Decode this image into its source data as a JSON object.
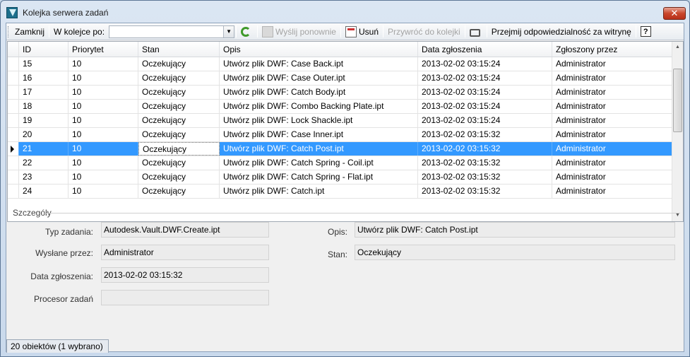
{
  "window": {
    "title": "Kolejka serwera zadań",
    "close_label": "✕"
  },
  "toolbar": {
    "close_label": "Zamknij",
    "queue_label": "W kolejce po:",
    "queue_value": "",
    "resend_label": "Wyślij ponownie",
    "delete_label": "Usuń",
    "restore_label": "Przywróć do kolejki",
    "take_label": "Przejmij odpowiedzialność za witrynę",
    "help_label": "?"
  },
  "grid": {
    "columns": [
      "ID",
      "Priorytet",
      "Stan",
      "Opis",
      "Data zgłoszenia",
      "Zgłoszony przez"
    ],
    "rows": [
      [
        "15",
        "10",
        "Oczekujący",
        "Utwórz plik DWF: Case Back.ipt",
        "2013-02-02 03:15:24",
        "Administrator"
      ],
      [
        "16",
        "10",
        "Oczekujący",
        "Utwórz plik DWF: Case Outer.ipt",
        "2013-02-02 03:15:24",
        "Administrator"
      ],
      [
        "17",
        "10",
        "Oczekujący",
        "Utwórz plik DWF: Catch Body.ipt",
        "2013-02-02 03:15:24",
        "Administrator"
      ],
      [
        "18",
        "10",
        "Oczekujący",
        "Utwórz plik DWF: Combo Backing Plate.ipt",
        "2013-02-02 03:15:24",
        "Administrator"
      ],
      [
        "19",
        "10",
        "Oczekujący",
        "Utwórz plik DWF: Lock Shackle.ipt",
        "2013-02-02 03:15:24",
        "Administrator"
      ],
      [
        "20",
        "10",
        "Oczekujący",
        "Utwórz plik DWF: Case Inner.ipt",
        "2013-02-02 03:15:32",
        "Administrator"
      ],
      [
        "21",
        "10",
        "Oczekujący",
        "Utwórz plik DWF: Catch Post.ipt",
        "2013-02-02 03:15:32",
        "Administrator"
      ],
      [
        "22",
        "10",
        "Oczekujący",
        "Utwórz plik DWF: Catch Spring - Coil.ipt",
        "2013-02-02 03:15:32",
        "Administrator"
      ],
      [
        "23",
        "10",
        "Oczekujący",
        "Utwórz plik DWF: Catch Spring - Flat.ipt",
        "2013-02-02 03:15:32",
        "Administrator"
      ],
      [
        "24",
        "10",
        "Oczekujący",
        "Utwórz plik DWF: Catch.ipt",
        "2013-02-02 03:15:32",
        "Administrator"
      ]
    ],
    "selected_index": 6
  },
  "details": {
    "section_label": "Szczegóły",
    "job_type_label": "Typ zadania:",
    "job_type_value": "Autodesk.Vault.DWF.Create.ipt",
    "sent_by_label": "Wysłane przez:",
    "sent_by_value": "Administrator",
    "submit_date_label": "Data zgłoszenia:",
    "submit_date_value": "2013-02-02 03:15:32",
    "processor_label": "Procesor zadań",
    "processor_value": "",
    "desc_label": "Opis:",
    "desc_value": "Utwórz plik DWF: Catch Post.ipt",
    "state_label": "Stan:",
    "state_value": "Oczekujący"
  },
  "status": {
    "text": "20 obiektów (1 wybrano)"
  },
  "colors": {
    "selection": "#3399ff",
    "frame": "#c7d8ea"
  }
}
